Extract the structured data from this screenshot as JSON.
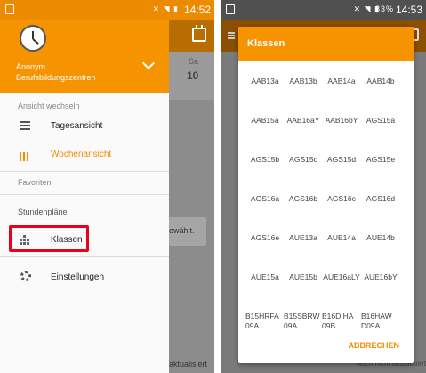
{
  "left_phone": {
    "status_time": "14:52",
    "drawer": {
      "account_name": "Anonym",
      "account_school": "Berufsbildungszentren",
      "section_view": "Ansicht wechseln",
      "item_day": "Tagesansicht",
      "item_week": "Wochenansicht",
      "section_favorites": "Favoriten",
      "section_timetables": "Stundenpläne",
      "item_classes": "Klassen",
      "item_settings": "Einstellungen"
    },
    "underlay": {
      "day": "Sa",
      "date": "10",
      "chip": "ewählt.",
      "footer": "aktualisiert"
    },
    "accent": "#f59400",
    "highlight_color": "#e8001c"
  },
  "right_phone": {
    "status_battery": "83%",
    "status_time": "14:53",
    "dialog_title": "Klassen",
    "classes": [
      [
        "AAB13a",
        "AAB13b",
        "AAB14a",
        "AAB14b"
      ],
      [
        "AAB15a",
        "AAB16aY",
        "AAB16bY",
        "AGS15a"
      ],
      [
        "AGS15b",
        "AGS15c",
        "AGS15d",
        "AGS15e"
      ],
      [
        "AGS16a",
        "AGS16b",
        "AGS16c",
        "AGS16d"
      ],
      [
        "AGS16e",
        "AUE13a",
        "AUE14a",
        "AUE14b"
      ],
      [
        "AUE15a",
        "AUE15b",
        "AUE16aLY",
        "AUE16bY"
      ],
      [
        "B15HRFA 09A",
        "B15SBRW 09A",
        "B16DIHA 09B",
        "B16HAW D09A"
      ]
    ],
    "cancel_label": "ABBRECHEN",
    "footer": "Noch nicht aktualisiert"
  }
}
